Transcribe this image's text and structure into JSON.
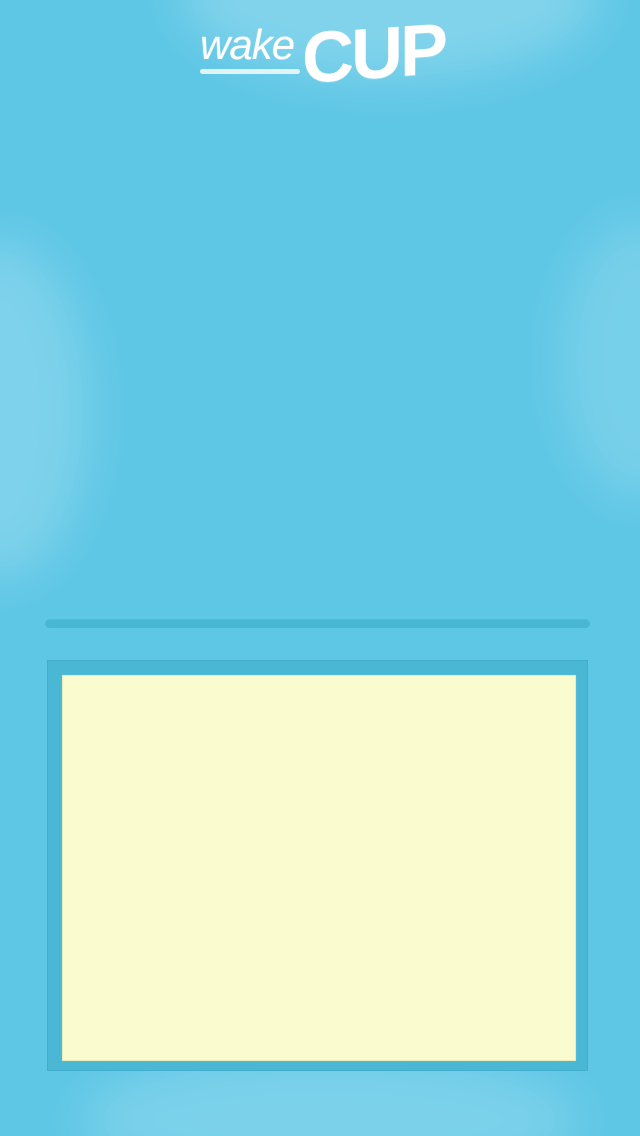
{
  "app": {
    "logo": {
      "word_left": "wake",
      "word_right": "CUP"
    }
  },
  "colors": {
    "background": "#5ec7e6",
    "panel": "#4ab7d4",
    "divider": "#49b6d4",
    "note": "#fbfbd0",
    "logo": "#ffffff"
  }
}
